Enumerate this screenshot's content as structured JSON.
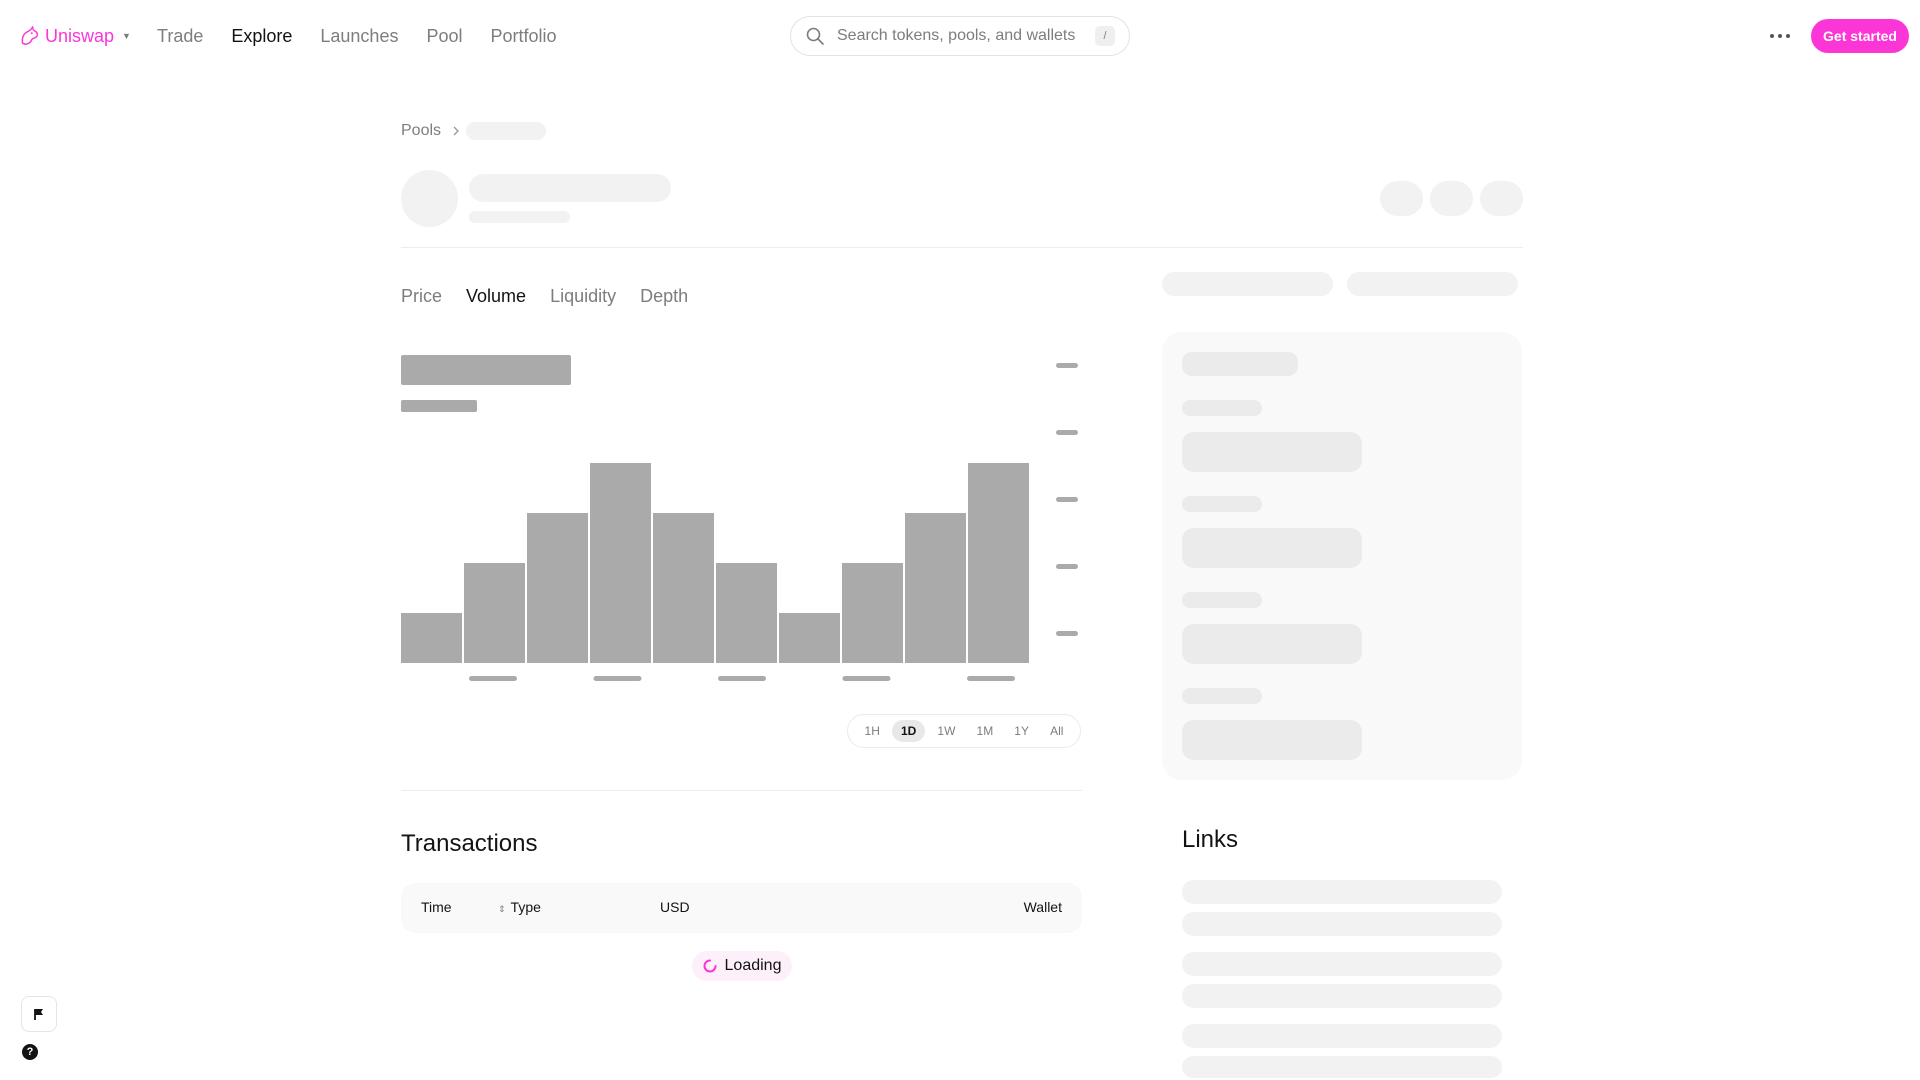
{
  "brand": {
    "name": "Uniswap",
    "accent_color": "#FC35D7"
  },
  "nav": {
    "links": [
      "Trade",
      "Explore",
      "Launches",
      "Pool",
      "Portfolio"
    ],
    "active": "Explore"
  },
  "search": {
    "placeholder": "Search tokens, pools, and wallets",
    "shortcut": "/"
  },
  "header_actions": {
    "get_started_label": "Get started",
    "more_icon": "ellipsis-icon"
  },
  "breadcrumb": {
    "root": "Pools"
  },
  "chart_tabs": {
    "items": [
      "Price",
      "Volume",
      "Liquidity",
      "Depth"
    ],
    "active": "Volume"
  },
  "chart_data": {
    "type": "bar",
    "state": "loading-placeholder",
    "values": [
      1,
      2,
      3,
      4,
      3,
      2,
      1,
      2,
      3,
      4
    ],
    "bar_color": "#AAAAAA"
  },
  "time_ranges": {
    "items": [
      "1H",
      "1D",
      "1W",
      "1M",
      "1Y",
      "All"
    ],
    "active": "1D"
  },
  "transactions": {
    "title": "Transactions",
    "columns": {
      "time": "Time",
      "type": "Type",
      "usd": "USD",
      "wallet": "Wallet"
    },
    "loading_label": "Loading"
  },
  "links": {
    "title": "Links"
  },
  "floating": {
    "flag_icon": "flag-icon",
    "help_label": "?"
  }
}
